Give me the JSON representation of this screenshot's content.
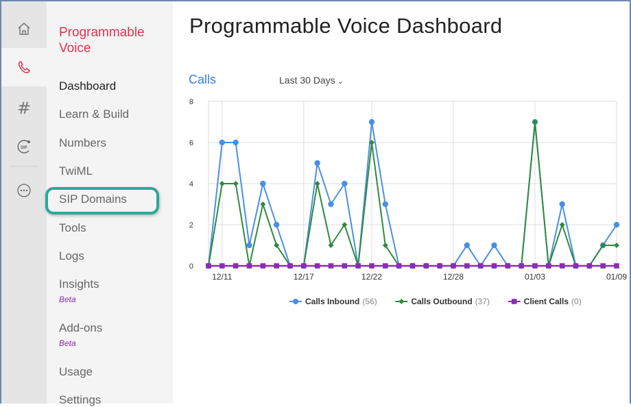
{
  "app": {
    "section_title": "Programmable Voice",
    "page_title": "Programmable Voice Dashboard"
  },
  "icon_rail": [
    {
      "icon": "home-icon",
      "active": false
    },
    {
      "icon": "phone-icon",
      "active": true
    },
    {
      "icon": "hash-icon",
      "active": false
    },
    {
      "icon": "sip-icon",
      "active": false
    },
    {
      "icon": "more-icon",
      "active": false
    }
  ],
  "nav": {
    "items": [
      {
        "label": "Dashboard",
        "active": true
      },
      {
        "label": "Learn & Build"
      },
      {
        "label": "Numbers"
      },
      {
        "label": "TwiML"
      },
      {
        "label": "SIP Domains",
        "highlighted": true
      },
      {
        "label": "Tools"
      },
      {
        "label": "Logs"
      },
      {
        "label": "Insights",
        "badge": "Beta"
      },
      {
        "label": "Add-ons",
        "badge": "Beta"
      },
      {
        "label": "Usage"
      },
      {
        "label": "Settings"
      }
    ]
  },
  "calls": {
    "label": "Calls",
    "range": "Last 30 Days"
  },
  "colors": {
    "inbound": "#4a8fe7",
    "outbound": "#2f8a3e",
    "client": "#8a2db5",
    "accent": "#e0334e",
    "highlight": "#2aa89a"
  },
  "chart_data": {
    "type": "line",
    "x_ticks": [
      "12/11",
      "12/17",
      "12/22",
      "12/28",
      "01/03",
      "01/09"
    ],
    "x_tick_index": [
      1,
      7,
      12,
      18,
      24,
      30
    ],
    "ylim": [
      0,
      8
    ],
    "y_ticks": [
      "0",
      "2",
      "4",
      "6",
      "8"
    ],
    "grid": true,
    "legend_position": "bottom",
    "series": [
      {
        "name": "Calls Inbound",
        "count": "(56)",
        "marker": "circle",
        "values": [
          0,
          6,
          6,
          1,
          4,
          2,
          0,
          0,
          5,
          3,
          4,
          0,
          7,
          3,
          0,
          0,
          0,
          0,
          0,
          1,
          0,
          1,
          0,
          0,
          7,
          0,
          3,
          0,
          0,
          1,
          2
        ]
      },
      {
        "name": "Calls Outbound",
        "count": "(37)",
        "marker": "diamond",
        "values": [
          0,
          4,
          4,
          0,
          3,
          1,
          0,
          0,
          4,
          1,
          2,
          0,
          6,
          1,
          0,
          0,
          0,
          0,
          0,
          0,
          0,
          0,
          0,
          0,
          7,
          0,
          2,
          0,
          0,
          1,
          1
        ]
      },
      {
        "name": "Client Calls",
        "count": "(0)",
        "marker": "square",
        "values": [
          0,
          0,
          0,
          0,
          0,
          0,
          0,
          0,
          0,
          0,
          0,
          0,
          0,
          0,
          0,
          0,
          0,
          0,
          0,
          0,
          0,
          0,
          0,
          0,
          0,
          0,
          0,
          0,
          0,
          0,
          0
        ]
      }
    ]
  }
}
